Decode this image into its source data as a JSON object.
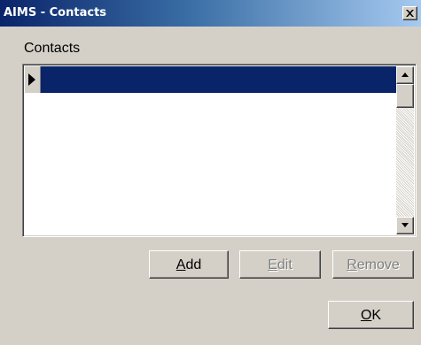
{
  "window": {
    "title": "AIMS - Contacts",
    "close_glyph": "×"
  },
  "contacts": {
    "label": "Contacts",
    "rows": [
      {
        "selected": true,
        "indicator_icon": "row-pointer-icon"
      }
    ],
    "selection_color": "#0a246a"
  },
  "buttons": {
    "add": {
      "mnemonic": "A",
      "rest": "dd",
      "enabled": true
    },
    "edit": {
      "mnemonic": "E",
      "rest": "dit",
      "enabled": false
    },
    "remove": {
      "mnemonic": "R",
      "rest": "emove",
      "enabled": false
    },
    "ok": {
      "mnemonic": "O",
      "rest": "K",
      "enabled": true
    }
  },
  "icons": {
    "close": "close-icon",
    "scroll_up": "scroll-up-arrow-icon",
    "scroll_down": "scroll-down-arrow-icon"
  },
  "colors": {
    "title_start": "#0a246a",
    "title_end": "#a6caf0",
    "face": "#d4d0c8"
  }
}
